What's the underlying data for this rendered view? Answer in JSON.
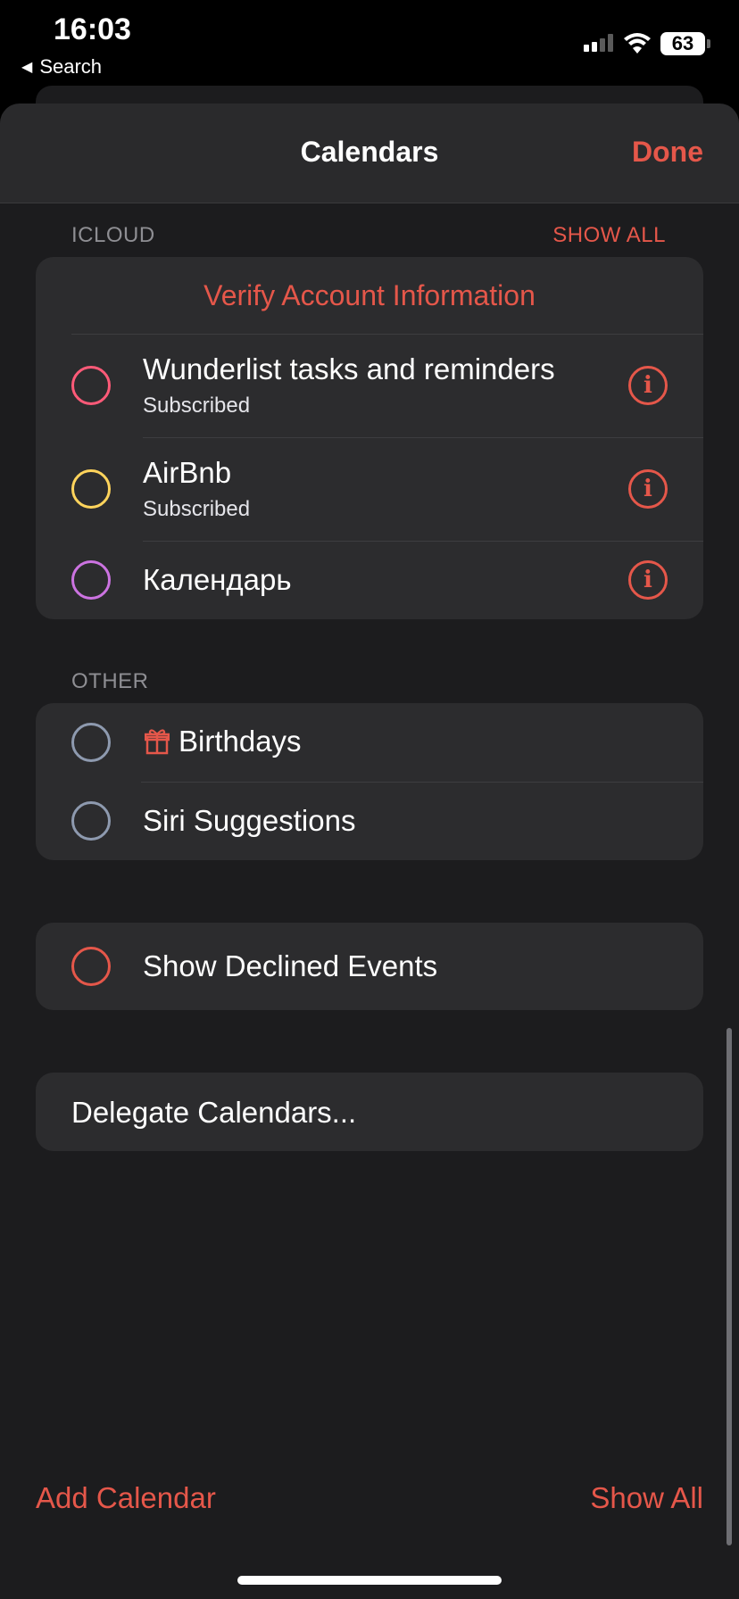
{
  "status_bar": {
    "time": "16:03",
    "back_label": "Search",
    "battery": "63"
  },
  "header": {
    "title": "Calendars",
    "done_label": "Done"
  },
  "icloud": {
    "header": "ICLOUD",
    "show_all": "SHOW ALL",
    "verify": "Verify Account Information",
    "items": [
      {
        "title": "Wunderlist tasks and reminders",
        "subtitle": "Subscribed",
        "color": "#ff5a78"
      },
      {
        "title": "AirBnb",
        "subtitle": "Subscribed",
        "color": "#ffd45c"
      },
      {
        "title": "Календарь",
        "color": "#cc73e1"
      }
    ]
  },
  "other": {
    "header": "OTHER",
    "items": [
      {
        "title": "Birthdays",
        "icon": "gift-icon",
        "color": "#8e9aaf"
      },
      {
        "title": "Siri Suggestions",
        "color": "#8e9aaf"
      }
    ]
  },
  "declined": {
    "title": "Show Declined Events",
    "color": "#e5574a"
  },
  "delegate": {
    "title": "Delegate Calendars..."
  },
  "footer": {
    "add_calendar": "Add Calendar",
    "show_all": "Show All"
  },
  "accent_color": "#e5574a"
}
